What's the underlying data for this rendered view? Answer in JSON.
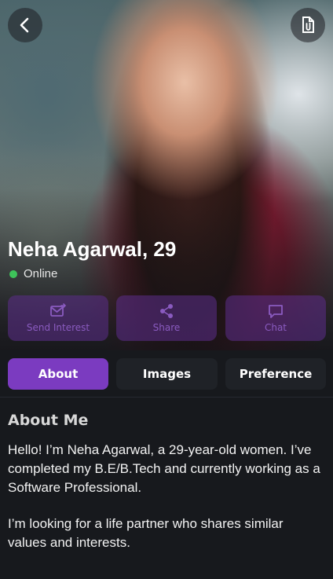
{
  "profile": {
    "name_age": "Neha Agarwal, 29",
    "status": "Online",
    "status_color": "#3ec35a"
  },
  "top_bar": {
    "back_icon": "chevron-left-icon",
    "right_icon": "document-attachment-icon"
  },
  "actions": [
    {
      "label": "Send Interest",
      "icon": "send-interest-icon"
    },
    {
      "label": "Share",
      "icon": "share-icon"
    },
    {
      "label": "Chat",
      "icon": "chat-bubble-icon"
    }
  ],
  "tabs": [
    {
      "label": "About",
      "active": true
    },
    {
      "label": "Images",
      "active": false
    },
    {
      "label": "Preference",
      "active": false
    }
  ],
  "about": {
    "title": "About Me",
    "paragraph_1": "Hello! I’m Neha Agarwal, a 29-year-old women. I’ve completed my B.E/B.Tech and currently working as a Software Professional.",
    "paragraph_2": "I’m looking for a life partner who shares similar values and interests."
  },
  "colors": {
    "accent": "#7b3bc0",
    "background": "#17191d"
  }
}
